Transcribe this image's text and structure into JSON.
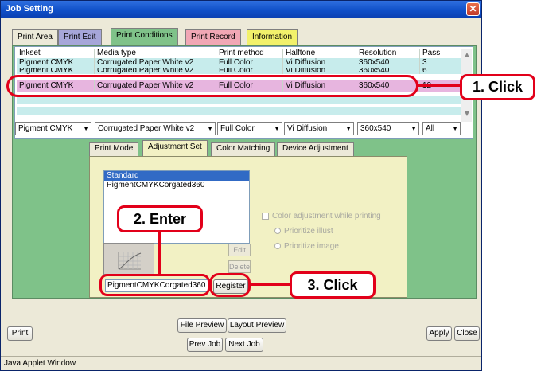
{
  "window": {
    "title": "Job Setting",
    "close_symbol": "✕"
  },
  "outer_tabs": [
    {
      "label": "Print Area",
      "color": "#ece9d8"
    },
    {
      "label": "Print Edit",
      "color": "#a6a6d9"
    },
    {
      "label": "Print Conditions",
      "color": "#7fc289"
    },
    {
      "label": "Print Record",
      "color": "#f1a7b5"
    },
    {
      "label": "Information",
      "color": "#f2f16b"
    }
  ],
  "grid": {
    "headers": [
      "Inkset",
      "Media type",
      "Print method",
      "Halftone",
      "Resolution",
      "Pass"
    ],
    "rows": [
      [
        "Pigment CMYK",
        "Corrugated Paper White v2",
        "Full Color",
        "Vi Diffusion",
        "360x540",
        "3"
      ],
      [
        "Pigment CMYK",
        "Corrugated Paper White v2",
        "Full Color",
        "Vi Diffusion",
        "360x540",
        "6"
      ],
      [
        "Pigment CMYK",
        "Corrugated Paper White v2",
        "Full Color",
        "Vi Diffusion",
        "360x540",
        "12"
      ]
    ],
    "scroll_up": "▲",
    "scroll_down": "▼"
  },
  "filters": {
    "inkset": "Pigment CMYK",
    "media": "Corrugated Paper White v2",
    "method": "Full Color",
    "halftone": "Vi Diffusion",
    "resolution": "360x540",
    "pass": "All",
    "arrow": "▼"
  },
  "inner_tabs": [
    "Print Mode",
    "Adjustment Set",
    "Color Matching",
    "Device Adjustment"
  ],
  "adjustment_list": [
    "Standard",
    "PigmentCMYKCorgated360"
  ],
  "buttons": {
    "edit": "Edit",
    "delete": "Delete",
    "register": "Register",
    "file_preview": "File Preview",
    "layout_preview": "Layout Preview",
    "prev_job": "Prev Job",
    "next_job": "Next Job",
    "print": "Print",
    "apply": "Apply",
    "close": "Close"
  },
  "name_input_value": "PigmentCMYKCorgated360",
  "options": {
    "color_adjust": "Color adjustment while printing",
    "prioritize_illust": "Prioritize illust",
    "prioritize_image": "Prioritize image"
  },
  "status_bar": "Java Applet Window",
  "annotations": {
    "step1": "1. Click",
    "step2": "2. Enter",
    "step3": "3. Click",
    "color": "#e2001a"
  }
}
